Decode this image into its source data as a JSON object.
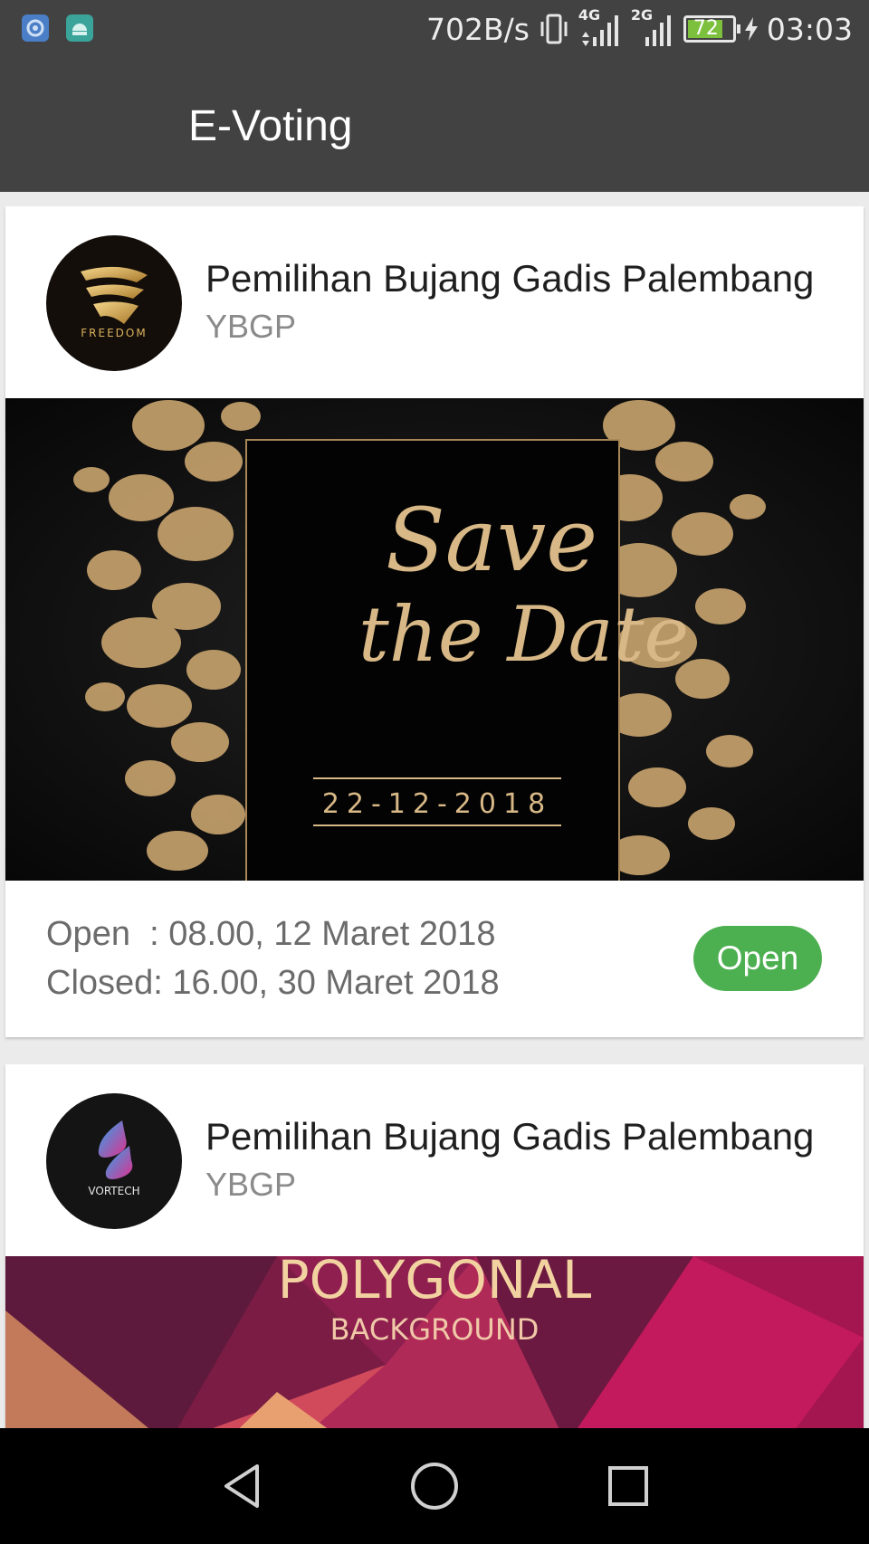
{
  "status_bar": {
    "speed": "702B/s",
    "net1": "4G",
    "net2": "2G",
    "battery": "72",
    "time": "03:03"
  },
  "app_bar": {
    "title": "E-Voting"
  },
  "cards": [
    {
      "title": "Pemilihan Bujang Gadis Palembang",
      "org": "YBGP",
      "avatar_text": "FREEDOM",
      "banner": {
        "script_line1": "Save",
        "script_line2": "the Date",
        "date": "22-12-2018"
      },
      "open_line": "Open  : 08.00, 12 Maret 2018",
      "closed_line": "Closed: 16.00, 30 Maret 2018",
      "status": "Open",
      "status_color": "#4caf50"
    },
    {
      "title": "Pemilihan Bujang Gadis Palembang",
      "org": "YBGP",
      "avatar_text": "VORTECH",
      "banner": {
        "title": "POLYGONAL",
        "subtitle": "BACKGROUND"
      }
    }
  ],
  "nav": {
    "back_icon": "back-triangle",
    "home_icon": "home-circle",
    "recents_icon": "recents-square"
  }
}
